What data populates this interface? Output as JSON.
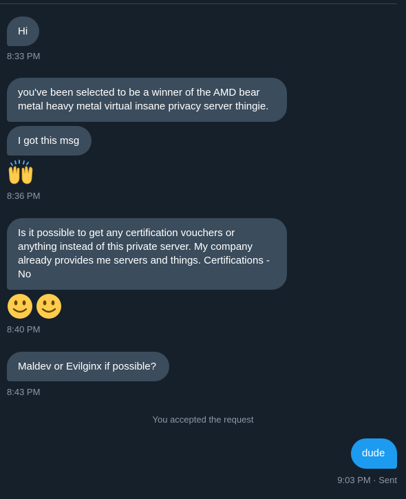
{
  "messages": {
    "m1": {
      "text": "Hi",
      "time": "8:33 PM"
    },
    "m2": {
      "text": "you've been selected to be a winner of the AMD bear metal heavy metal virtual insane privacy server thingie."
    },
    "m3": {
      "text": "I got this msg",
      "time": "8:36 PM"
    },
    "m4": {
      "text": "Is it possible to get any certification vouchers or anything instead of this private server. My company already provides me servers and things. Certifications - No",
      "time": "8:40 PM"
    },
    "m5": {
      "text": "Maldev or Evilginx if possible?",
      "time": "8:43 PM"
    }
  },
  "notice": "You accepted the request",
  "sent": {
    "text": "dude",
    "time": "9:03 PM · Sent"
  },
  "icons": {
    "raising_hands": "raising-hands-emoji",
    "smiley": "slightly-smiling-face-emoji"
  },
  "colors": {
    "background": "#15202b",
    "received_bubble": "#3b4c5c",
    "sent_bubble": "#1d9bf0",
    "muted_text": "#8b98a5"
  }
}
